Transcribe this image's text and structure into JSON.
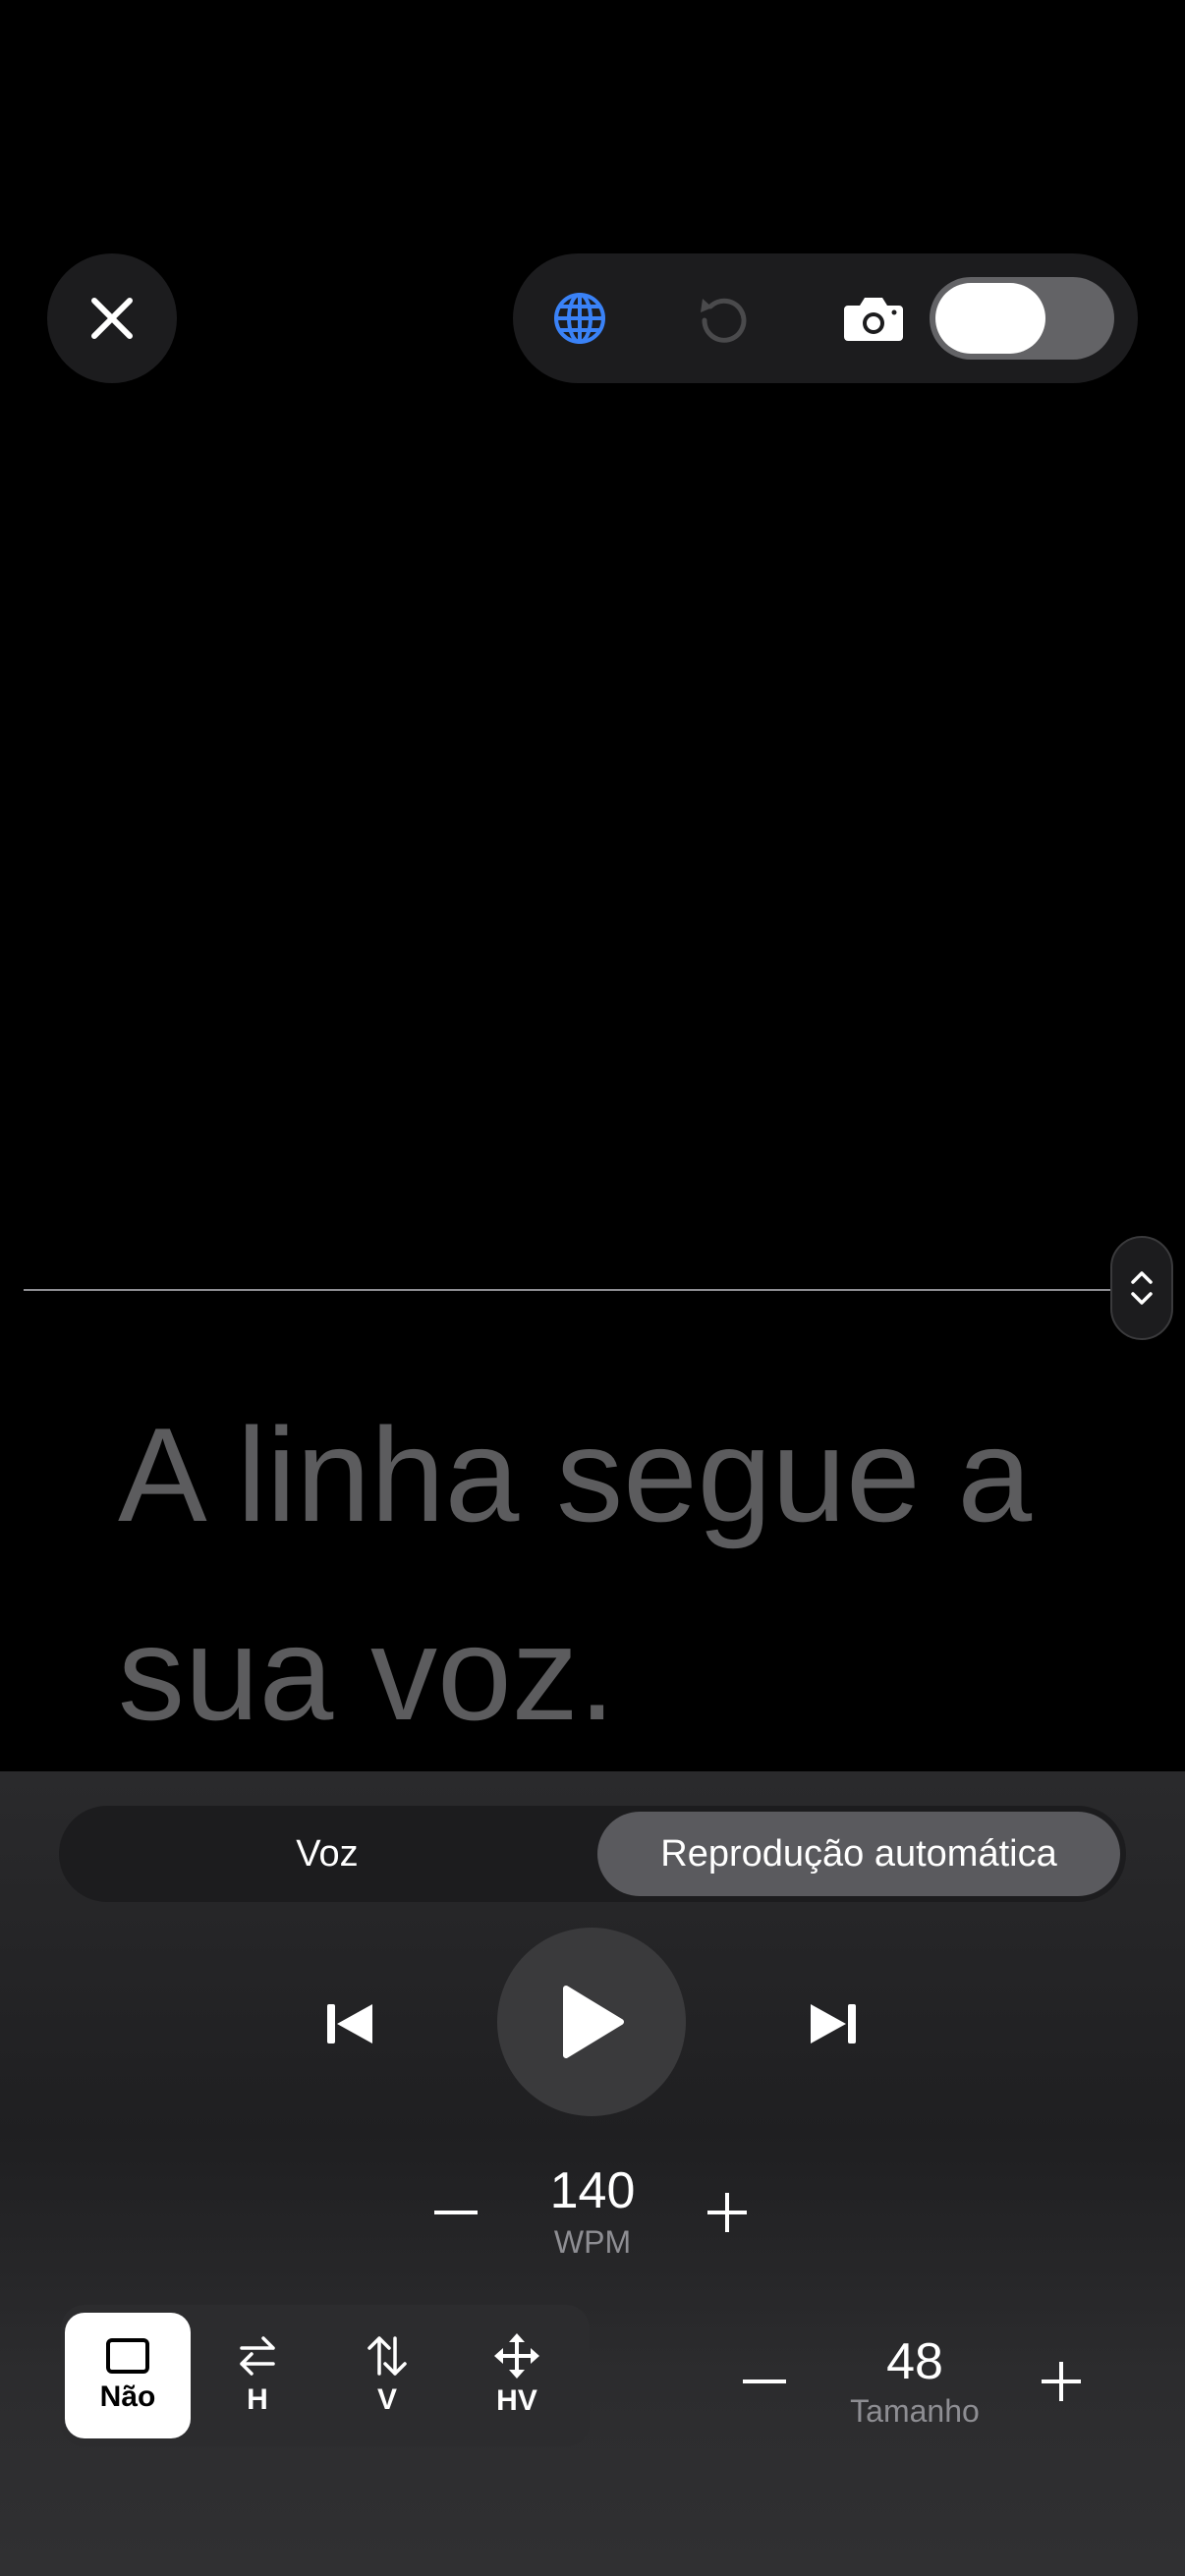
{
  "toolbar": {
    "close_icon": "xmark-icon",
    "globe_icon": "globe-icon",
    "reset_icon": "rotate-left-icon",
    "camera_icon": "camera-icon",
    "camera_toggle_on": false,
    "accent_color": "#3a82f7"
  },
  "script": {
    "line1": "A linha segue a",
    "line2": "sua voz."
  },
  "mode_tabs": [
    {
      "label": "Voz",
      "selected": false
    },
    {
      "label": "Reprodução automática",
      "selected": true
    }
  ],
  "playback": {
    "prev_icon": "skip-back-icon",
    "play_icon": "play-icon",
    "next_icon": "skip-forward-icon"
  },
  "speed": {
    "minus": "–",
    "value": "140",
    "unit": "WPM",
    "plus": "+"
  },
  "mirror": {
    "options": [
      {
        "label": "Não",
        "icon": "square-icon",
        "selected": true
      },
      {
        "label": "H",
        "icon": "arrows-left-right-icon",
        "selected": false
      },
      {
        "label": "V",
        "icon": "arrows-up-down-icon",
        "selected": false
      },
      {
        "label": "HV",
        "icon": "arrows-move-icon",
        "selected": false
      }
    ]
  },
  "size": {
    "minus": "–",
    "value": "48",
    "unit": "Tamanho",
    "plus": "+"
  }
}
